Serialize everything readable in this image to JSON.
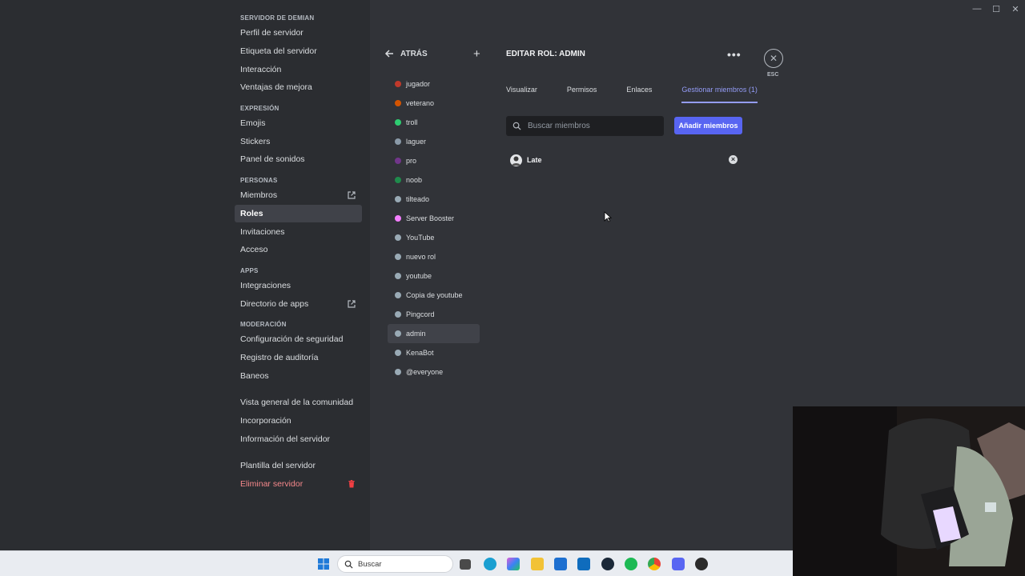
{
  "window_controls": [
    "—",
    "☐",
    "✕"
  ],
  "sidebar": {
    "sections": [
      {
        "header": "SERVIDOR DE DEMIAN",
        "items": [
          {
            "label": "Perfil de servidor"
          },
          {
            "label": "Etiqueta del servidor"
          },
          {
            "label": "Interacción"
          },
          {
            "label": "Ventajas de mejora"
          }
        ]
      },
      {
        "header": "EXPRESIÓN",
        "items": [
          {
            "label": "Emojis"
          },
          {
            "label": "Stickers"
          },
          {
            "label": "Panel de sonidos"
          }
        ]
      },
      {
        "header": "PERSONAS",
        "items": [
          {
            "label": "Miembros",
            "icon": "external-link-icon"
          },
          {
            "label": "Roles",
            "active": true
          },
          {
            "label": "Invitaciones"
          },
          {
            "label": "Acceso"
          }
        ]
      },
      {
        "header": "APPS",
        "items": [
          {
            "label": "Integraciones"
          },
          {
            "label": "Directorio de apps",
            "icon": "external-link-icon"
          }
        ]
      },
      {
        "header": "MODERACIÓN",
        "items": [
          {
            "label": "Configuración de seguridad"
          },
          {
            "label": "Registro de auditoría"
          },
          {
            "label": "Baneos"
          }
        ]
      },
      {
        "header": "",
        "items": [
          {
            "label": "Vista general de la comunidad"
          },
          {
            "label": "Incorporación"
          },
          {
            "label": "Información del servidor"
          }
        ]
      },
      {
        "header": "",
        "items": [
          {
            "label": "Plantilla del servidor"
          },
          {
            "label": "Eliminar servidor",
            "danger": true,
            "icon": "trash-icon"
          }
        ]
      }
    ]
  },
  "roles_panel": {
    "back_label": "ATRÁS",
    "add_icon": "plus-icon",
    "roles": [
      {
        "name": "jugador",
        "color": "#c0392b"
      },
      {
        "name": "veterano",
        "color": "#d35400"
      },
      {
        "name": "troll",
        "color": "#2ecc71"
      },
      {
        "name": "laguer",
        "color": "#8a9aa8"
      },
      {
        "name": "pro",
        "color": "#71368a"
      },
      {
        "name": "noob",
        "color": "#1f8b4c"
      },
      {
        "name": "tilteado",
        "color": "#99aab5"
      },
      {
        "name": "Server Booster",
        "color": "#f47fff"
      },
      {
        "name": "YouTube",
        "color": "#99aab5"
      },
      {
        "name": "nuevo rol",
        "color": "#99aab5"
      },
      {
        "name": "youtube",
        "color": "#99aab5"
      },
      {
        "name": "Copia de youtube",
        "color": "#99aab5"
      },
      {
        "name": "Pingcord",
        "color": "#99aab5"
      },
      {
        "name": "admin",
        "color": "#99aab5",
        "active": true
      },
      {
        "name": "KenaBot",
        "color": "#99aab5"
      },
      {
        "name": "@everyone",
        "color": "#99aab5"
      }
    ]
  },
  "editor": {
    "title": "EDITAR ROL: ADMIN",
    "tabs": [
      {
        "label": "Visualizar"
      },
      {
        "label": "Permisos"
      },
      {
        "label": "Enlaces"
      },
      {
        "label": "Gestionar miembros (1)",
        "active": true
      }
    ],
    "search_placeholder": "Buscar miembros",
    "add_members_label": "Añadir miembros",
    "members": [
      {
        "name": "Late"
      }
    ]
  },
  "close": {
    "label": "ESC"
  },
  "taskbar": {
    "search_label": "Buscar"
  },
  "colors": {
    "accent": "#5865f2",
    "active_tab": "#949cf7",
    "danger": "#f5888b"
  }
}
